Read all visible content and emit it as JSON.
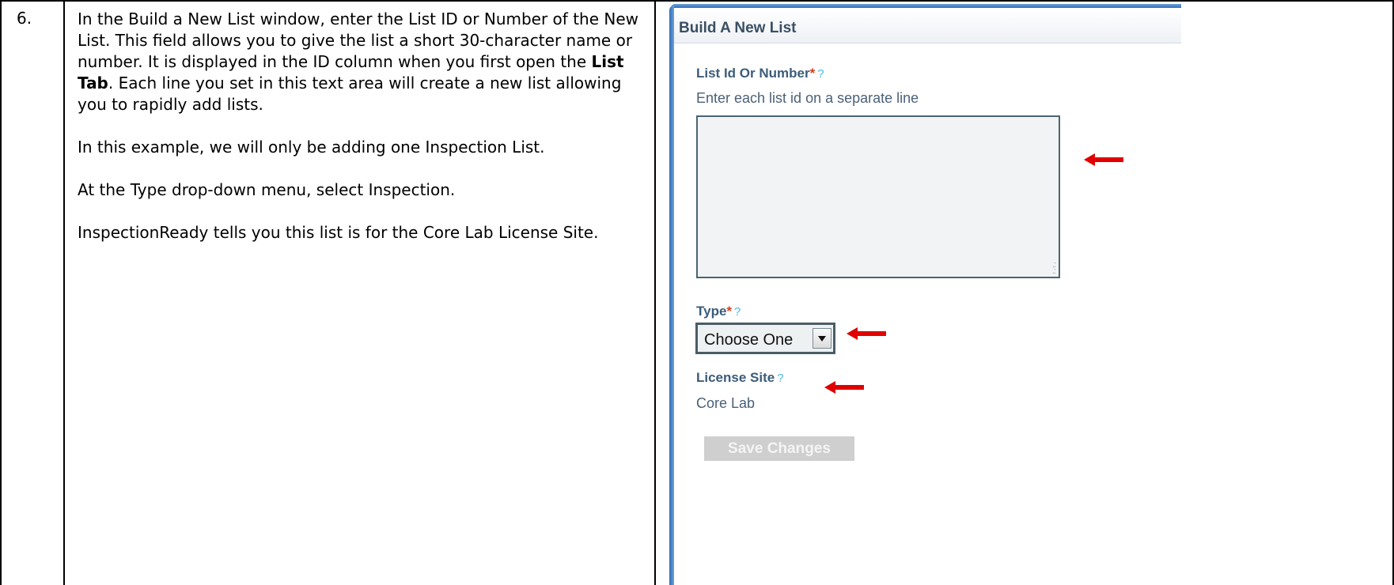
{
  "step": {
    "number": "6.",
    "paragraph1_before": "In the Build a New List window, enter the List ID or Number of the New List.  This field allows you to give the list a short 30-character name or number.  It is displayed in the ID column when you first open the ",
    "paragraph1_bold": "List Tab",
    "paragraph1_after": ".  Each line you set in this text area will create a new list allowing you to rapidly add lists.",
    "paragraph2": "In this example, we will only be adding one Inspection List.",
    "paragraph3": "At the Type drop-down menu, select Inspection.",
    "paragraph4": "InspectionReady tells you this list is for the Core Lab License Site."
  },
  "dialog": {
    "title": "Build A New List",
    "list_id": {
      "label": "List Id Or Number",
      "required_mark": "*",
      "help_mark": "?",
      "hint": "Enter each list id on a separate line",
      "value": ""
    },
    "type": {
      "label": "Type",
      "required_mark": "*",
      "help_mark": "?",
      "selected": "Choose One"
    },
    "license_site": {
      "label": "License Site",
      "help_mark": "?",
      "value": "Core Lab"
    },
    "save_button": "Save Changes"
  },
  "icons": {
    "arrow": "left-arrow-icon",
    "dropdown": "chevron-down-icon",
    "resize": "resize-grip-icon"
  },
  "colors": {
    "arrow": "#e00000",
    "label": "#3b5c7a",
    "required": "#d4401e",
    "help": "#4cb8e8",
    "header_border": "#2f6fb8"
  }
}
